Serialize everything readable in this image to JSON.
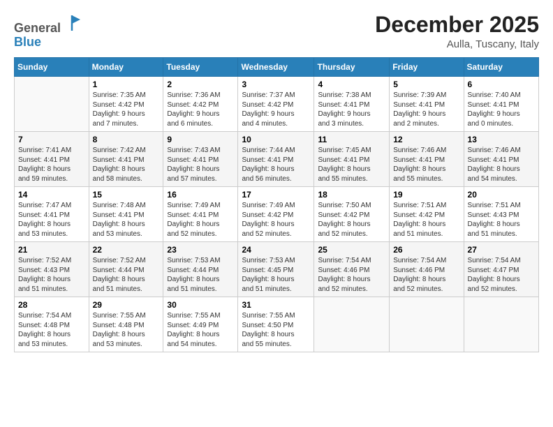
{
  "app": {
    "logo_general": "General",
    "logo_blue": "Blue"
  },
  "header": {
    "month": "December 2025",
    "location": "Aulla, Tuscany, Italy"
  },
  "weekdays": [
    "Sunday",
    "Monday",
    "Tuesday",
    "Wednesday",
    "Thursday",
    "Friday",
    "Saturday"
  ],
  "weeks": [
    [
      {
        "day": "",
        "info": ""
      },
      {
        "day": "1",
        "info": "Sunrise: 7:35 AM\nSunset: 4:42 PM\nDaylight: 9 hours\nand 7 minutes."
      },
      {
        "day": "2",
        "info": "Sunrise: 7:36 AM\nSunset: 4:42 PM\nDaylight: 9 hours\nand 6 minutes."
      },
      {
        "day": "3",
        "info": "Sunrise: 7:37 AM\nSunset: 4:42 PM\nDaylight: 9 hours\nand 4 minutes."
      },
      {
        "day": "4",
        "info": "Sunrise: 7:38 AM\nSunset: 4:41 PM\nDaylight: 9 hours\nand 3 minutes."
      },
      {
        "day": "5",
        "info": "Sunrise: 7:39 AM\nSunset: 4:41 PM\nDaylight: 9 hours\nand 2 minutes."
      },
      {
        "day": "6",
        "info": "Sunrise: 7:40 AM\nSunset: 4:41 PM\nDaylight: 9 hours\nand 0 minutes."
      }
    ],
    [
      {
        "day": "7",
        "info": "Sunrise: 7:41 AM\nSunset: 4:41 PM\nDaylight: 8 hours\nand 59 minutes."
      },
      {
        "day": "8",
        "info": "Sunrise: 7:42 AM\nSunset: 4:41 PM\nDaylight: 8 hours\nand 58 minutes."
      },
      {
        "day": "9",
        "info": "Sunrise: 7:43 AM\nSunset: 4:41 PM\nDaylight: 8 hours\nand 57 minutes."
      },
      {
        "day": "10",
        "info": "Sunrise: 7:44 AM\nSunset: 4:41 PM\nDaylight: 8 hours\nand 56 minutes."
      },
      {
        "day": "11",
        "info": "Sunrise: 7:45 AM\nSunset: 4:41 PM\nDaylight: 8 hours\nand 55 minutes."
      },
      {
        "day": "12",
        "info": "Sunrise: 7:46 AM\nSunset: 4:41 PM\nDaylight: 8 hours\nand 55 minutes."
      },
      {
        "day": "13",
        "info": "Sunrise: 7:46 AM\nSunset: 4:41 PM\nDaylight: 8 hours\nand 54 minutes."
      }
    ],
    [
      {
        "day": "14",
        "info": "Sunrise: 7:47 AM\nSunset: 4:41 PM\nDaylight: 8 hours\nand 53 minutes."
      },
      {
        "day": "15",
        "info": "Sunrise: 7:48 AM\nSunset: 4:41 PM\nDaylight: 8 hours\nand 53 minutes."
      },
      {
        "day": "16",
        "info": "Sunrise: 7:49 AM\nSunset: 4:41 PM\nDaylight: 8 hours\nand 52 minutes."
      },
      {
        "day": "17",
        "info": "Sunrise: 7:49 AM\nSunset: 4:42 PM\nDaylight: 8 hours\nand 52 minutes."
      },
      {
        "day": "18",
        "info": "Sunrise: 7:50 AM\nSunset: 4:42 PM\nDaylight: 8 hours\nand 52 minutes."
      },
      {
        "day": "19",
        "info": "Sunrise: 7:51 AM\nSunset: 4:42 PM\nDaylight: 8 hours\nand 51 minutes."
      },
      {
        "day": "20",
        "info": "Sunrise: 7:51 AM\nSunset: 4:43 PM\nDaylight: 8 hours\nand 51 minutes."
      }
    ],
    [
      {
        "day": "21",
        "info": "Sunrise: 7:52 AM\nSunset: 4:43 PM\nDaylight: 8 hours\nand 51 minutes."
      },
      {
        "day": "22",
        "info": "Sunrise: 7:52 AM\nSunset: 4:44 PM\nDaylight: 8 hours\nand 51 minutes."
      },
      {
        "day": "23",
        "info": "Sunrise: 7:53 AM\nSunset: 4:44 PM\nDaylight: 8 hours\nand 51 minutes."
      },
      {
        "day": "24",
        "info": "Sunrise: 7:53 AM\nSunset: 4:45 PM\nDaylight: 8 hours\nand 51 minutes."
      },
      {
        "day": "25",
        "info": "Sunrise: 7:54 AM\nSunset: 4:46 PM\nDaylight: 8 hours\nand 52 minutes."
      },
      {
        "day": "26",
        "info": "Sunrise: 7:54 AM\nSunset: 4:46 PM\nDaylight: 8 hours\nand 52 minutes."
      },
      {
        "day": "27",
        "info": "Sunrise: 7:54 AM\nSunset: 4:47 PM\nDaylight: 8 hours\nand 52 minutes."
      }
    ],
    [
      {
        "day": "28",
        "info": "Sunrise: 7:54 AM\nSunset: 4:48 PM\nDaylight: 8 hours\nand 53 minutes."
      },
      {
        "day": "29",
        "info": "Sunrise: 7:55 AM\nSunset: 4:48 PM\nDaylight: 8 hours\nand 53 minutes."
      },
      {
        "day": "30",
        "info": "Sunrise: 7:55 AM\nSunset: 4:49 PM\nDaylight: 8 hours\nand 54 minutes."
      },
      {
        "day": "31",
        "info": "Sunrise: 7:55 AM\nSunset: 4:50 PM\nDaylight: 8 hours\nand 55 minutes."
      },
      {
        "day": "",
        "info": ""
      },
      {
        "day": "",
        "info": ""
      },
      {
        "day": "",
        "info": ""
      }
    ]
  ]
}
